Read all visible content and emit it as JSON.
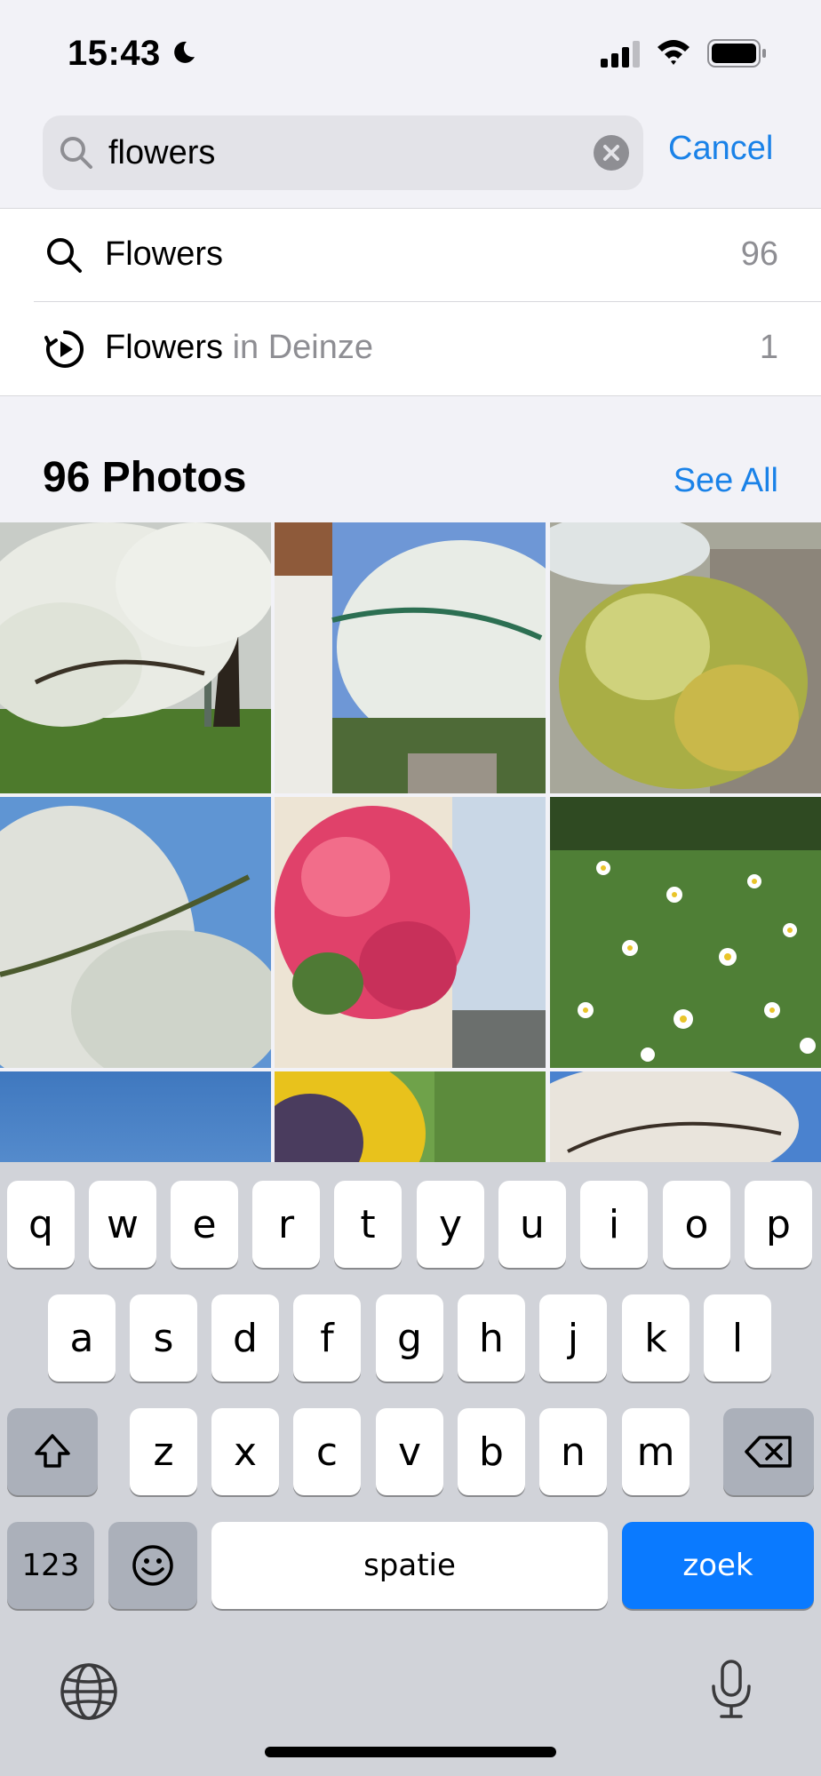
{
  "status_bar": {
    "time": "15:43",
    "icons": [
      "moon-icon",
      "cellular-signal-icon",
      "wifi-icon",
      "battery-icon"
    ]
  },
  "search": {
    "value": "flowers",
    "cancel_label": "Cancel"
  },
  "suggestions": [
    {
      "icon": "search-icon",
      "label": "Flowers",
      "sub": "",
      "count": "96"
    },
    {
      "icon": "memory-play-icon",
      "label": "Flowers",
      "sub": " in Deinze",
      "count": "1"
    }
  ],
  "photos": {
    "title": "96 Photos",
    "see_all_label": "See All"
  },
  "keyboard": {
    "row1": [
      "q",
      "w",
      "e",
      "r",
      "t",
      "y",
      "u",
      "i",
      "o",
      "p"
    ],
    "row2": [
      "a",
      "s",
      "d",
      "f",
      "g",
      "h",
      "j",
      "k",
      "l"
    ],
    "row3": [
      "z",
      "x",
      "c",
      "v",
      "b",
      "n",
      "m"
    ],
    "numbers_label": "123",
    "space_label": "spatie",
    "return_label": "zoek"
  },
  "colors": {
    "accent": "#1a82e8",
    "return_key": "#0a7aff",
    "background": "#f2f2f7",
    "keyboard": "#d1d3d9"
  }
}
